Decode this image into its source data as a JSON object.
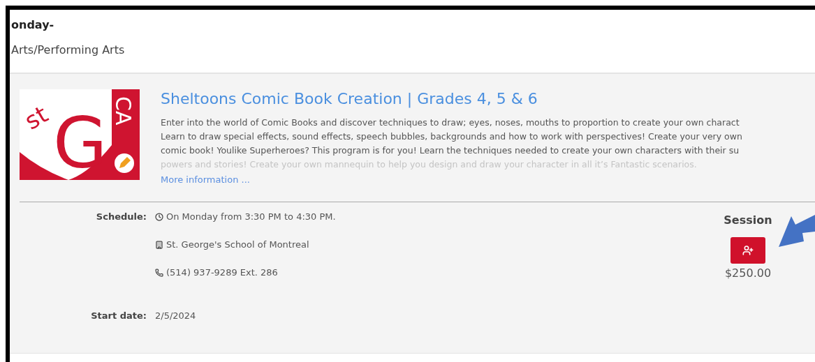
{
  "heading": "onday-",
  "category": "Arts/Performing Arts",
  "logo": {
    "initials": "st",
    "letter": "G",
    "side": "CA"
  },
  "course": {
    "title": "Sheltoons Comic Book Creation | Grades 4, 5 & 6",
    "description_lines": [
      "Enter into the world of Comic Books and discover techniques to draw; eyes, noses, mouths to proportion to create your own charact",
      "Learn to draw special effects, sound effects, speech bubbles, backgrounds and how to work with perspectives! Create your very own",
      "comic book! Youlike Superheroes? This program is for you! Learn the techniques needed to create your own characters with their su",
      "powers and stories! Create your own mannequin to help you design and draw your character in all it’s Fantastic scenarios."
    ],
    "more_link": "More information ..."
  },
  "details": [
    {
      "label": "Schedule:",
      "items": [
        {
          "kind": "clock",
          "text": "On Monday from 3:30 PM to 4:30 PM."
        },
        {
          "kind": "building",
          "text": "St. George's School of Montreal"
        },
        {
          "kind": "phone",
          "text": "(514) 937-9289 Ext. 286"
        }
      ]
    },
    {
      "label": "Start date:",
      "items": [
        {
          "kind": "plain",
          "text": "2/5/2024"
        }
      ]
    }
  ],
  "session": {
    "heading": "Session",
    "price": "$250.00"
  }
}
